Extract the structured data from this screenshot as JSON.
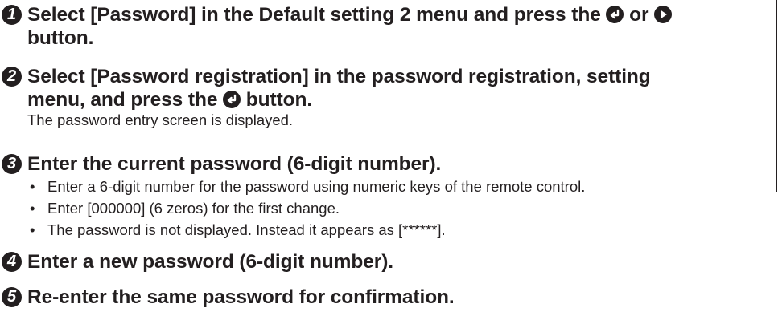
{
  "steps": [
    {
      "number": "1",
      "head_part1": "Select [Password] in the Default setting 2 menu and press the",
      "head_or": "or",
      "head_line2": "button."
    },
    {
      "number": "2",
      "head_line1": "Select [Password registration] in the password registration, setting",
      "head_line2a": "menu, and press the",
      "head_line2b": "button.",
      "body": "The password entry screen is displayed."
    },
    {
      "number": "3",
      "head": "Enter the current password (6-digit number).",
      "bullets": [
        "Enter a 6-digit number for the password using numeric keys of the remote control.",
        "Enter [000000] (6 zeros) for the first change.",
        "The password is not displayed. Instead it appears as [******]."
      ]
    },
    {
      "number": "4",
      "head": "Enter a new password (6-digit number)."
    },
    {
      "number": "5",
      "head": "Re-enter the same password for confirmation."
    }
  ],
  "bullet_char": "•",
  "icons": {
    "enter": "enter-button-icon",
    "right": "right-arrow-button-icon"
  }
}
